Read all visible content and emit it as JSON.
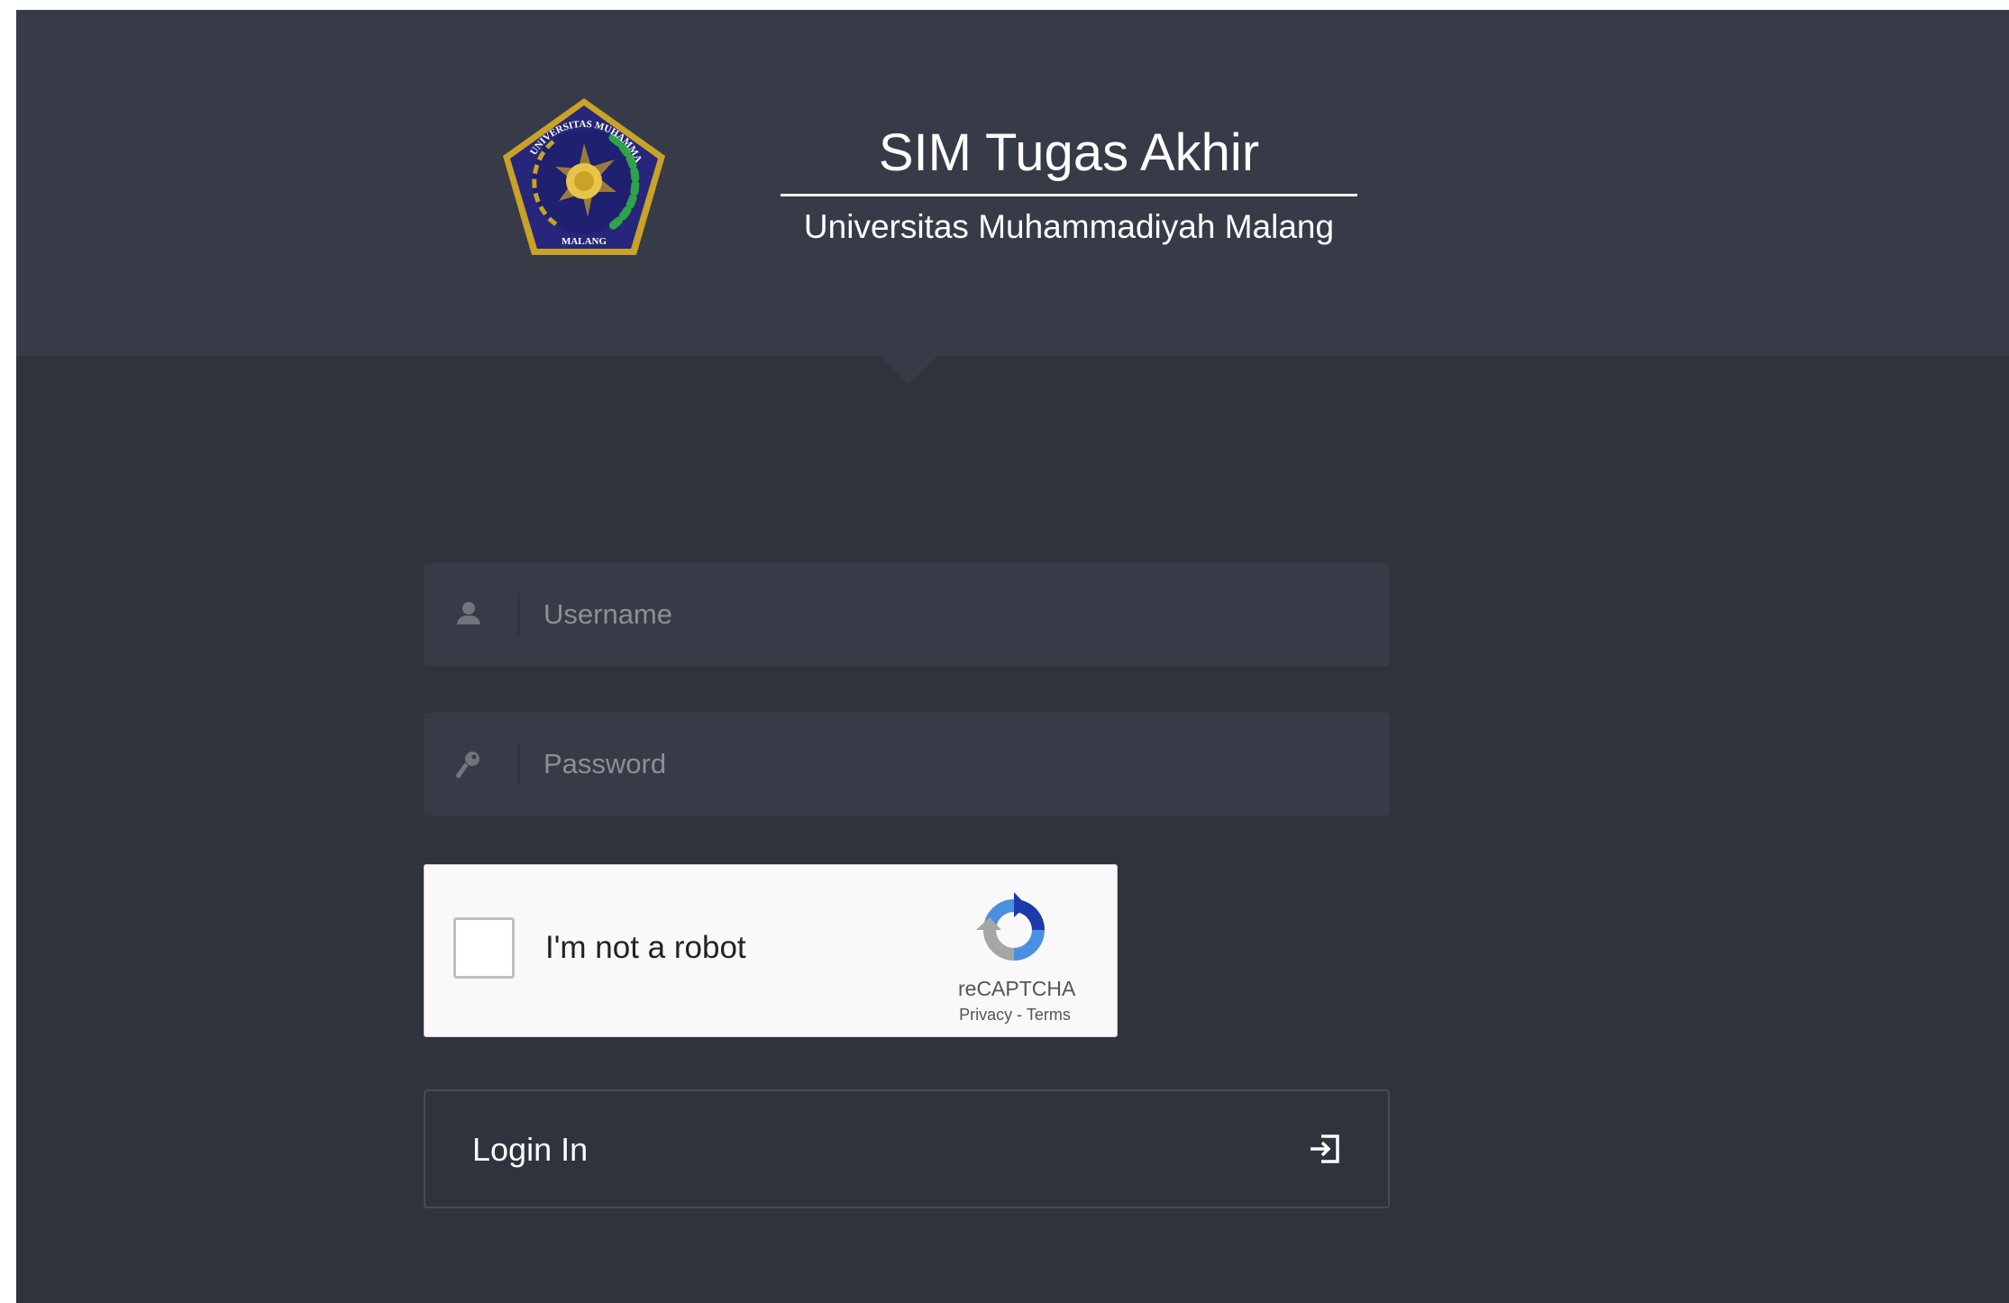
{
  "header": {
    "title": "SIM Tugas Akhir",
    "subtitle": "Universitas Muhammadiyah Malang",
    "logo_icon": "university-seal-icon",
    "logo_text_top": "UNIVERSITAS MUHAMMADIYAH",
    "logo_text_bottom": "MALANG"
  },
  "form": {
    "username": {
      "placeholder": "Username",
      "value": "",
      "icon": "user-icon"
    },
    "password": {
      "placeholder": "Password",
      "value": "",
      "icon": "key-icon"
    }
  },
  "captcha": {
    "label": "I'm not a robot",
    "brand": "reCAPTCHA",
    "links": "Privacy - Terms",
    "checked": false,
    "icon": "recaptcha-icon"
  },
  "login": {
    "label": "Login In",
    "icon": "sign-in-icon"
  },
  "colors": {
    "page_bg": "#2e333e",
    "header_bg": "#363b47",
    "field_bg": "#363b47",
    "text": "#ffffff",
    "placeholder": "#8a8f98"
  }
}
